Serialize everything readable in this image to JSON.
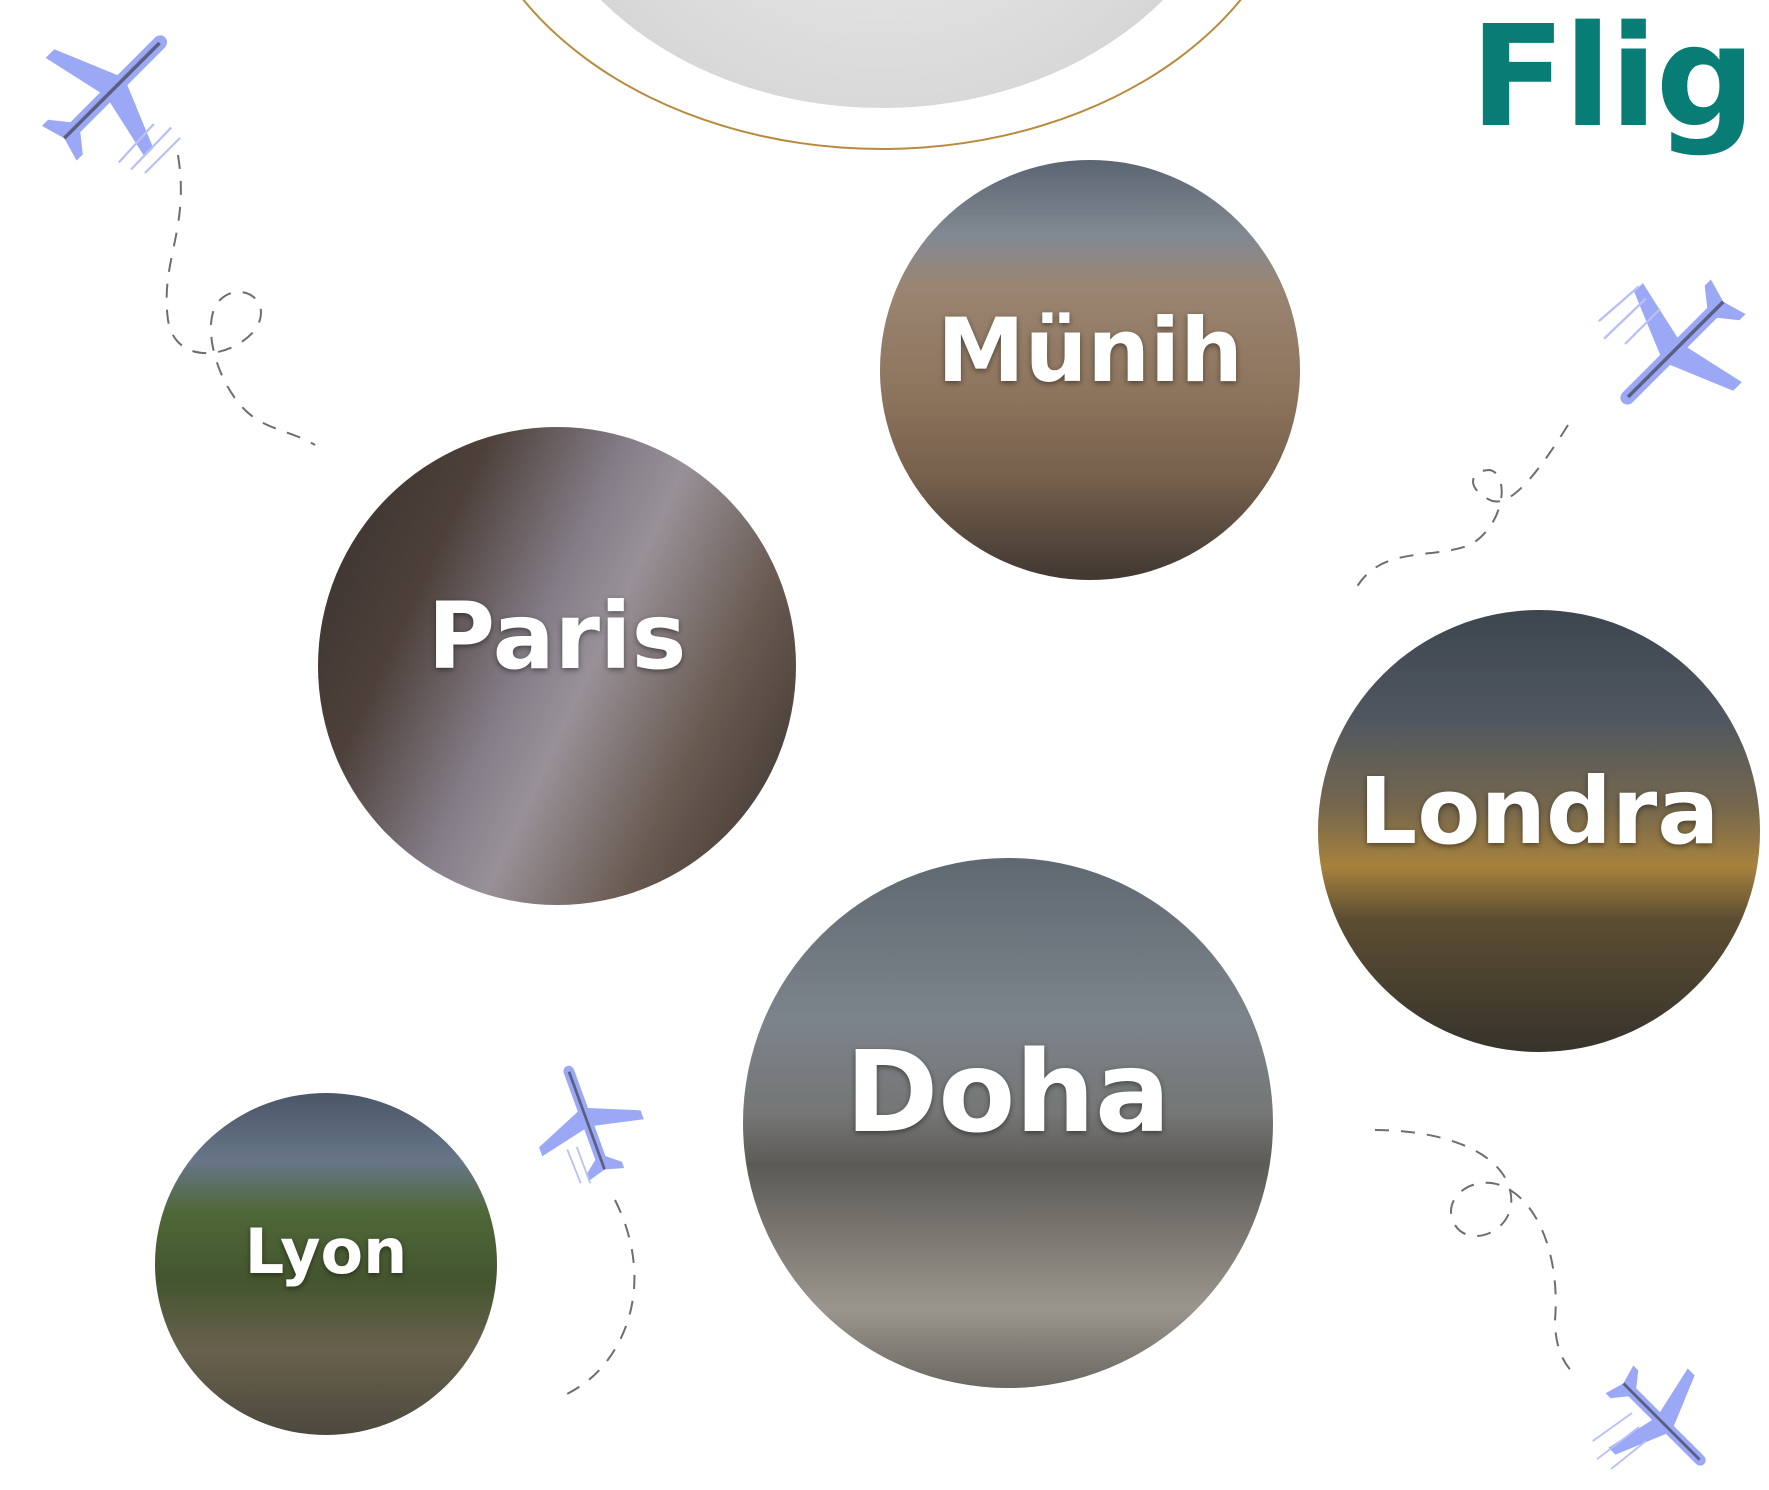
{
  "title": "Flig",
  "cities": {
    "munih": "Münih",
    "paris": "Paris",
    "londra": "Londra",
    "doha": "Doha",
    "lyon": "Lyon"
  },
  "colors": {
    "title": "#087d76",
    "plane": "#9aa8f5",
    "accent_ring": "#b98a3e"
  },
  "icons": {
    "plane": "airplane-icon"
  }
}
